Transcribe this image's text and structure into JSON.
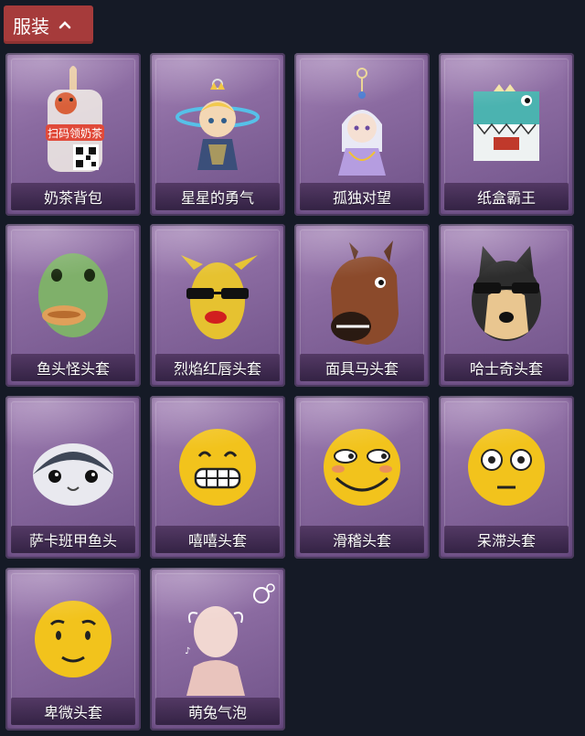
{
  "header": {
    "title": "服装"
  },
  "items": [
    {
      "label": "奶茶背包",
      "icon": "milk-tea-backpack-icon"
    },
    {
      "label": "星星的勇气",
      "icon": "star-courage-icon"
    },
    {
      "label": "孤独对望",
      "icon": "lonely-gaze-icon"
    },
    {
      "label": "纸盒霸王",
      "icon": "cardboard-dino-icon"
    },
    {
      "label": "鱼头怪头套",
      "icon": "fish-head-mask-icon"
    },
    {
      "label": "烈焰红唇头套",
      "icon": "red-lips-mask-icon"
    },
    {
      "label": "面具马头套",
      "icon": "horse-mask-icon"
    },
    {
      "label": "哈士奇头套",
      "icon": "husky-mask-icon"
    },
    {
      "label": "萨卡班甲鱼头",
      "icon": "sacabambaspis-head-icon"
    },
    {
      "label": "嘻嘻头套",
      "icon": "grin-emoji-mask-icon"
    },
    {
      "label": "滑稽头套",
      "icon": "funny-emoji-mask-icon"
    },
    {
      "label": "呆滞头套",
      "icon": "dazed-emoji-mask-icon"
    },
    {
      "label": "卑微头套",
      "icon": "humble-emoji-mask-icon"
    },
    {
      "label": "萌兔气泡",
      "icon": "cute-rabbit-bubble-icon"
    }
  ],
  "badge_text": "扫码领奶茶"
}
